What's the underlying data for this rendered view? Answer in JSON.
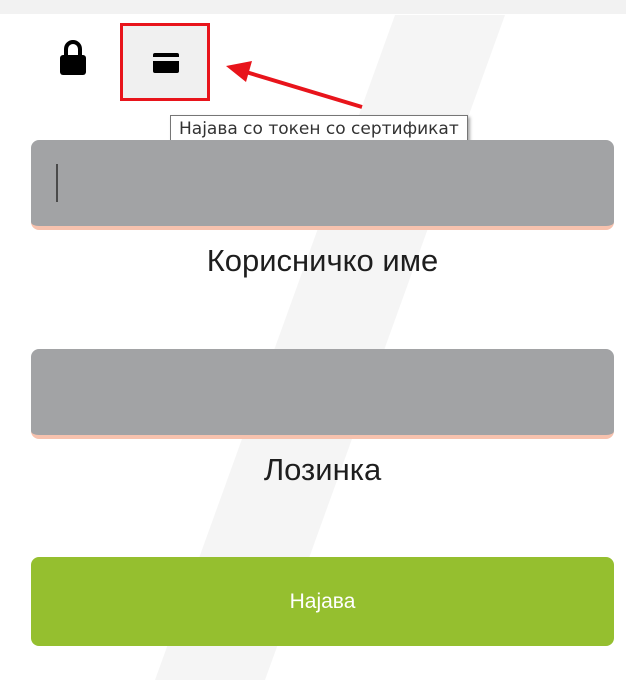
{
  "auth": {
    "tooltip": "Најава со токен со сертификат"
  },
  "form": {
    "username_label": "Корисничко име",
    "password_label": "Лозинка",
    "login_button": "Најава"
  },
  "colors": {
    "field_bg": "#a2a3a5",
    "field_underline": "#f7c2ae",
    "button_bg": "#95bf2f",
    "highlight_box": "#e8141b"
  },
  "icons": {
    "lock": "lock-icon",
    "card": "card-icon"
  }
}
